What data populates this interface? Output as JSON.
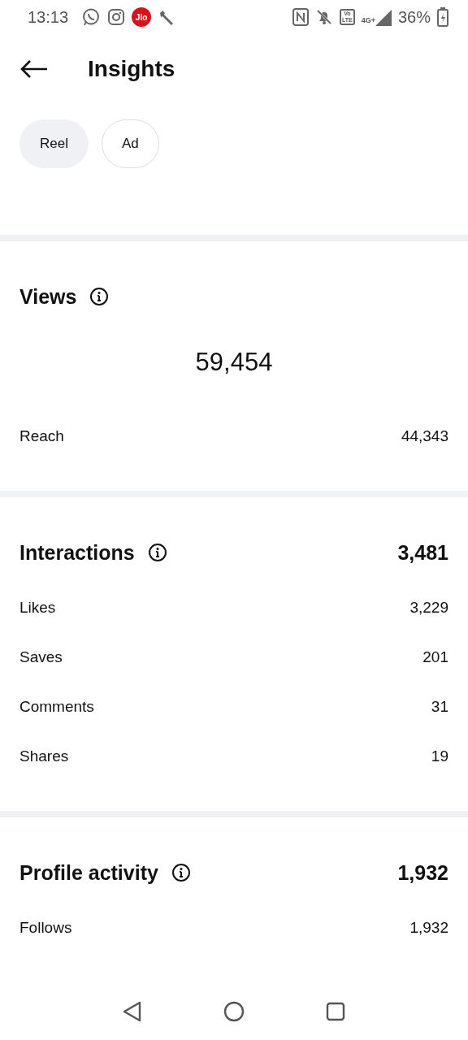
{
  "status_bar": {
    "time": "13:13",
    "carrier_badge": "Jio",
    "volte_top": "Vo",
    "volte_bottom": "LTE",
    "network": "4G+",
    "battery": "36%"
  },
  "header": {
    "title": "Insights"
  },
  "chips": [
    {
      "label": "Reel",
      "selected": true
    },
    {
      "label": "Ad",
      "selected": false
    }
  ],
  "sections": [
    {
      "title": "Views",
      "headline": "59,454",
      "rows": [
        {
          "label": "Reach",
          "value": "44,343"
        }
      ]
    },
    {
      "title": "Interactions",
      "total": "3,481",
      "rows": [
        {
          "label": "Likes",
          "value": "3,229"
        },
        {
          "label": "Saves",
          "value": "201"
        },
        {
          "label": "Comments",
          "value": "31"
        },
        {
          "label": "Shares",
          "value": "19"
        }
      ]
    },
    {
      "title": "Profile activity",
      "total": "1,932",
      "rows": [
        {
          "label": "Follows",
          "value": "1,932"
        }
      ]
    }
  ]
}
